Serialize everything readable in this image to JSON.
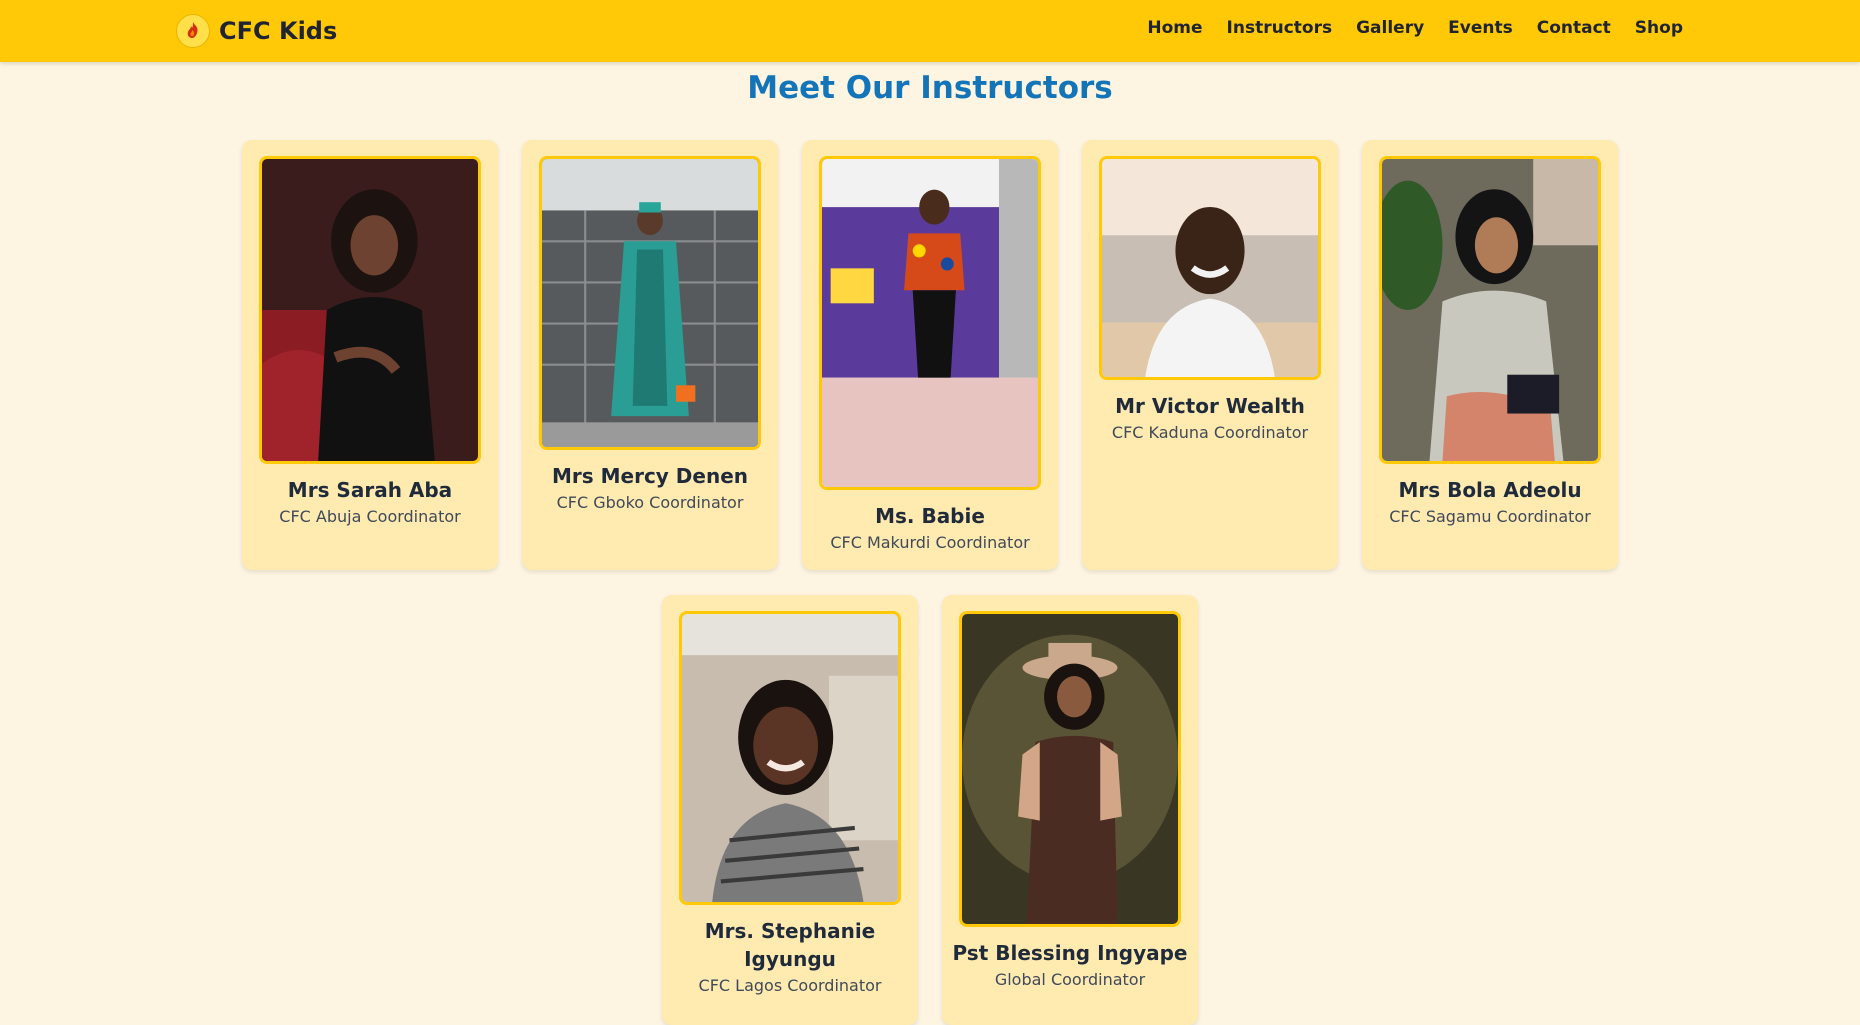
{
  "brand": {
    "name": "CFC Kids",
    "logo_icon": "flame-logo-icon"
  },
  "nav": {
    "links": [
      "Home",
      "Instructors",
      "Gallery",
      "Events",
      "Contact",
      "Shop"
    ]
  },
  "page": {
    "title": "Meet Our Instructors"
  },
  "instructors": [
    {
      "name": "Mrs Sarah Aba",
      "role": "CFC Abuja Coordinator"
    },
    {
      "name": "Mrs Mercy Denen",
      "role": "CFC Gboko Coordinator"
    },
    {
      "name": "Ms. Babie",
      "role": "CFC Makurdi Coordinator"
    },
    {
      "name": "Mr Victor Wealth",
      "role": "CFC Kaduna Coordinator"
    },
    {
      "name": "Mrs Bola Adeolu",
      "role": "CFC Sagamu Coordinator"
    },
    {
      "name": "Mrs. Stephanie Igyungu",
      "role": "CFC Lagos Coordinator"
    },
    {
      "name": "Pst Blessing Ingyape",
      "role": "Global Coordinator"
    }
  ],
  "colors": {
    "accent": "#ffc907",
    "title": "#1474b8",
    "card_bg": "#ffeab0",
    "page_bg": "#fdf5e1"
  }
}
